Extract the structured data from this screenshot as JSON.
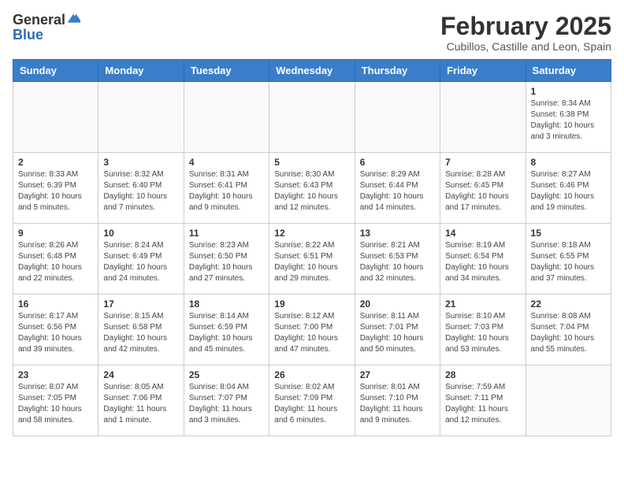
{
  "logo": {
    "general": "General",
    "blue": "Blue"
  },
  "header": {
    "month": "February 2025",
    "location": "Cubillos, Castille and Leon, Spain"
  },
  "weekdays": [
    "Sunday",
    "Monday",
    "Tuesday",
    "Wednesday",
    "Thursday",
    "Friday",
    "Saturday"
  ],
  "weeks": [
    [
      {
        "day": null
      },
      {
        "day": null
      },
      {
        "day": null
      },
      {
        "day": null
      },
      {
        "day": null
      },
      {
        "day": null
      },
      {
        "day": 1,
        "sunrise": "Sunrise: 8:34 AM",
        "sunset": "Sunset: 6:38 PM",
        "daylight": "Daylight: 10 hours and 3 minutes."
      }
    ],
    [
      {
        "day": 2,
        "sunrise": "Sunrise: 8:33 AM",
        "sunset": "Sunset: 6:39 PM",
        "daylight": "Daylight: 10 hours and 5 minutes."
      },
      {
        "day": 3,
        "sunrise": "Sunrise: 8:32 AM",
        "sunset": "Sunset: 6:40 PM",
        "daylight": "Daylight: 10 hours and 7 minutes."
      },
      {
        "day": 4,
        "sunrise": "Sunrise: 8:31 AM",
        "sunset": "Sunset: 6:41 PM",
        "daylight": "Daylight: 10 hours and 9 minutes."
      },
      {
        "day": 5,
        "sunrise": "Sunrise: 8:30 AM",
        "sunset": "Sunset: 6:43 PM",
        "daylight": "Daylight: 10 hours and 12 minutes."
      },
      {
        "day": 6,
        "sunrise": "Sunrise: 8:29 AM",
        "sunset": "Sunset: 6:44 PM",
        "daylight": "Daylight: 10 hours and 14 minutes."
      },
      {
        "day": 7,
        "sunrise": "Sunrise: 8:28 AM",
        "sunset": "Sunset: 6:45 PM",
        "daylight": "Daylight: 10 hours and 17 minutes."
      },
      {
        "day": 8,
        "sunrise": "Sunrise: 8:27 AM",
        "sunset": "Sunset: 6:46 PM",
        "daylight": "Daylight: 10 hours and 19 minutes."
      }
    ],
    [
      {
        "day": 9,
        "sunrise": "Sunrise: 8:26 AM",
        "sunset": "Sunset: 6:48 PM",
        "daylight": "Daylight: 10 hours and 22 minutes."
      },
      {
        "day": 10,
        "sunrise": "Sunrise: 8:24 AM",
        "sunset": "Sunset: 6:49 PM",
        "daylight": "Daylight: 10 hours and 24 minutes."
      },
      {
        "day": 11,
        "sunrise": "Sunrise: 8:23 AM",
        "sunset": "Sunset: 6:50 PM",
        "daylight": "Daylight: 10 hours and 27 minutes."
      },
      {
        "day": 12,
        "sunrise": "Sunrise: 8:22 AM",
        "sunset": "Sunset: 6:51 PM",
        "daylight": "Daylight: 10 hours and 29 minutes."
      },
      {
        "day": 13,
        "sunrise": "Sunrise: 8:21 AM",
        "sunset": "Sunset: 6:53 PM",
        "daylight": "Daylight: 10 hours and 32 minutes."
      },
      {
        "day": 14,
        "sunrise": "Sunrise: 8:19 AM",
        "sunset": "Sunset: 6:54 PM",
        "daylight": "Daylight: 10 hours and 34 minutes."
      },
      {
        "day": 15,
        "sunrise": "Sunrise: 8:18 AM",
        "sunset": "Sunset: 6:55 PM",
        "daylight": "Daylight: 10 hours and 37 minutes."
      }
    ],
    [
      {
        "day": 16,
        "sunrise": "Sunrise: 8:17 AM",
        "sunset": "Sunset: 6:56 PM",
        "daylight": "Daylight: 10 hours and 39 minutes."
      },
      {
        "day": 17,
        "sunrise": "Sunrise: 8:15 AM",
        "sunset": "Sunset: 6:58 PM",
        "daylight": "Daylight: 10 hours and 42 minutes."
      },
      {
        "day": 18,
        "sunrise": "Sunrise: 8:14 AM",
        "sunset": "Sunset: 6:59 PM",
        "daylight": "Daylight: 10 hours and 45 minutes."
      },
      {
        "day": 19,
        "sunrise": "Sunrise: 8:12 AM",
        "sunset": "Sunset: 7:00 PM",
        "daylight": "Daylight: 10 hours and 47 minutes."
      },
      {
        "day": 20,
        "sunrise": "Sunrise: 8:11 AM",
        "sunset": "Sunset: 7:01 PM",
        "daylight": "Daylight: 10 hours and 50 minutes."
      },
      {
        "day": 21,
        "sunrise": "Sunrise: 8:10 AM",
        "sunset": "Sunset: 7:03 PM",
        "daylight": "Daylight: 10 hours and 53 minutes."
      },
      {
        "day": 22,
        "sunrise": "Sunrise: 8:08 AM",
        "sunset": "Sunset: 7:04 PM",
        "daylight": "Daylight: 10 hours and 55 minutes."
      }
    ],
    [
      {
        "day": 23,
        "sunrise": "Sunrise: 8:07 AM",
        "sunset": "Sunset: 7:05 PM",
        "daylight": "Daylight: 10 hours and 58 minutes."
      },
      {
        "day": 24,
        "sunrise": "Sunrise: 8:05 AM",
        "sunset": "Sunset: 7:06 PM",
        "daylight": "Daylight: 11 hours and 1 minute."
      },
      {
        "day": 25,
        "sunrise": "Sunrise: 8:04 AM",
        "sunset": "Sunset: 7:07 PM",
        "daylight": "Daylight: 11 hours and 3 minutes."
      },
      {
        "day": 26,
        "sunrise": "Sunrise: 8:02 AM",
        "sunset": "Sunset: 7:09 PM",
        "daylight": "Daylight: 11 hours and 6 minutes."
      },
      {
        "day": 27,
        "sunrise": "Sunrise: 8:01 AM",
        "sunset": "Sunset: 7:10 PM",
        "daylight": "Daylight: 11 hours and 9 minutes."
      },
      {
        "day": 28,
        "sunrise": "Sunrise: 7:59 AM",
        "sunset": "Sunset: 7:11 PM",
        "daylight": "Daylight: 11 hours and 12 minutes."
      },
      {
        "day": null
      }
    ]
  ]
}
